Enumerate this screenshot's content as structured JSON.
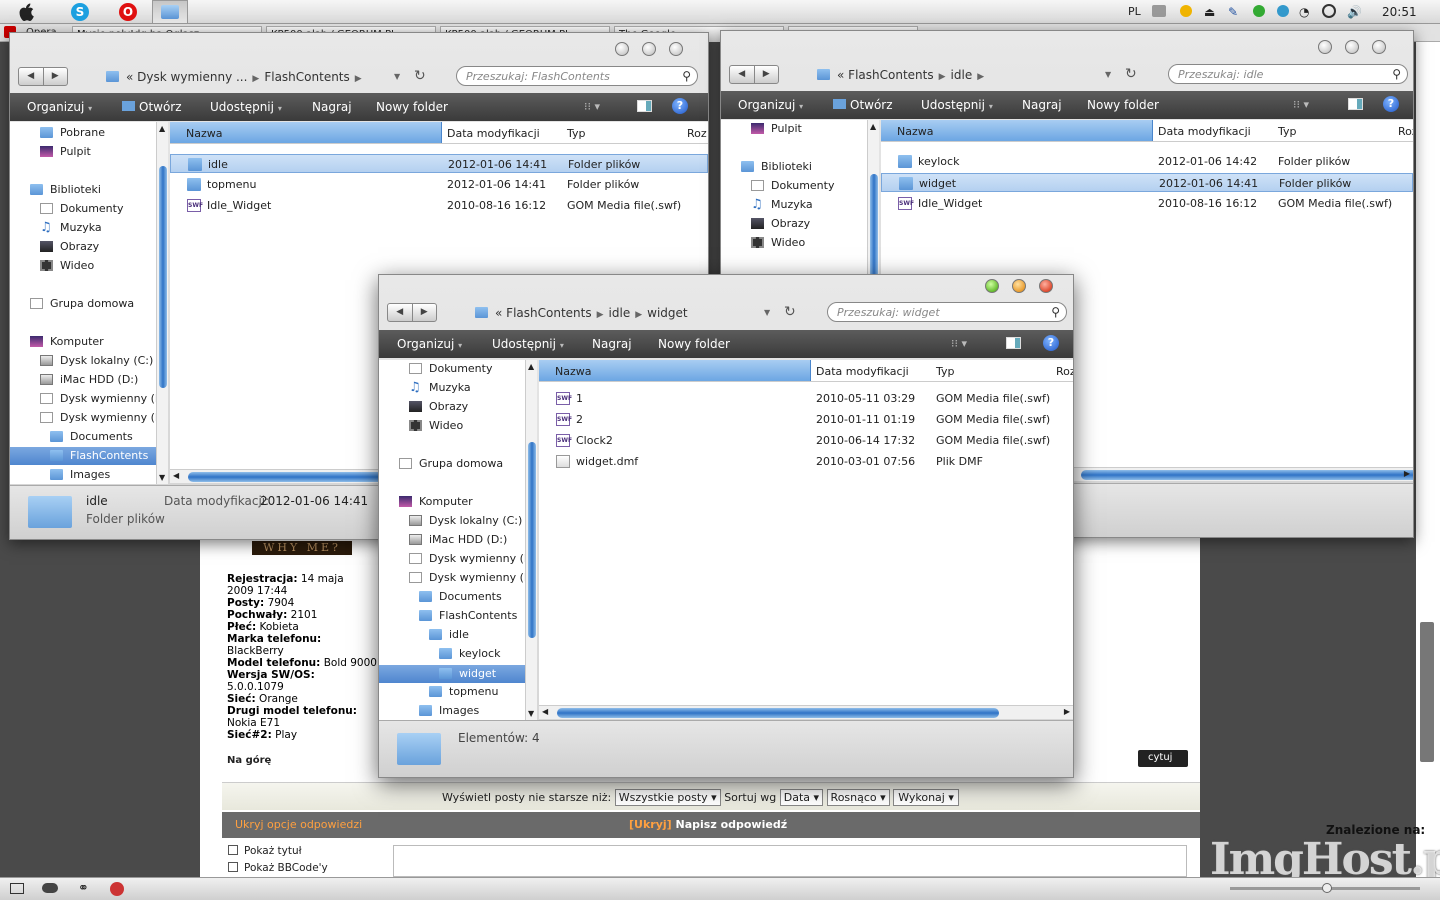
{
  "menubar": {
    "language": "PL",
    "clock": "20:51",
    "apps": [
      "apple-icon",
      "skype-icon",
      "opera-icon",
      "finder-icon"
    ]
  },
  "browser": {
    "app_name": "Opera",
    "tabs": [
      "Mysie poly!dg ha Oglasz",
      "KP500 alab / GEORUM PL",
      "KP500 alab / GEORUM PL",
      "The Google"
    ]
  },
  "forum": {
    "banner": "WHY ME?",
    "profile": [
      {
        "label": "Rejestracja:",
        "value": " 14 maja 2009 17:44"
      },
      {
        "label": "Posty:",
        "value": " 7904"
      },
      {
        "label": "Pochwały:",
        "value": " 2101"
      },
      {
        "label": "Płeć:",
        "value": " Kobieta"
      },
      {
        "label": "Marka telefonu:",
        "value": " BlackBerry"
      },
      {
        "label": "Model telefonu:",
        "value": " Bold 9000"
      },
      {
        "label": "Wersja SW/OS:",
        "value": " 5.0.0.1079"
      },
      {
        "label": "Sieć:",
        "value": " Orange"
      },
      {
        "label": "Drugi model telefonu:",
        "value": " Nokia E71"
      },
      {
        "label": "Sieć#2:",
        "value": " Play"
      }
    ],
    "top_link": "Na górę",
    "quote_button": "cytuj",
    "filter": {
      "label": "Wyświetl posty nie starsze niż:",
      "all_posts": "Wszystkie posty",
      "sort_label": "Sortuj wg",
      "sort_value": "Data",
      "order_value": "Rosnąco",
      "go_button": "Wykonaj"
    },
    "reply_bar": {
      "hide_options": "Ukryj opcje odpowiedzi",
      "hide_tag": "[Ukryj]",
      "write_reply": "Napisz odpowiedź"
    },
    "checkboxes": [
      "Pokaż tytuł",
      "Pokaż BBCode'y"
    ],
    "found_on": "Znalezione na:",
    "watermark": "ImgHost.pl"
  },
  "windows": {
    "w1": {
      "breadcrumb": [
        "«",
        "Dysk wymienny ...",
        "FlashContents"
      ],
      "search_placeholder": "Przeszukaj: FlashContents",
      "toolbar": {
        "organize": "Organizuj",
        "open": "Otwórz",
        "share": "Udostępnij",
        "burn": "Nagraj",
        "new_folder": "Nowy folder"
      },
      "columns": {
        "name": "Nazwa",
        "date": "Data modyfikacji",
        "type": "Typ",
        "size": "Roz"
      },
      "nav": [
        "Pobrane",
        "Pulpit",
        "Biblioteki",
        "Dokumenty",
        "Muzyka",
        "Obrazy",
        "Wideo",
        "Grupa domowa",
        "Komputer",
        "Dysk lokalny (C:)",
        "iMac HDD (D:)",
        "Dysk wymienny (F",
        "Dysk wymienny (I",
        "Documents",
        "FlashContents",
        "Images"
      ],
      "rows": [
        {
          "name": "idle",
          "date": "2012-01-06 14:41",
          "type": "Folder plików",
          "icon": "folder"
        },
        {
          "name": "topmenu",
          "date": "2012-01-06 14:41",
          "type": "Folder plików",
          "icon": "folder"
        },
        {
          "name": "Idle_Widget",
          "date": "2010-08-16 16:12",
          "type": "GOM Media file(.swf)",
          "icon": "swf"
        }
      ],
      "status": {
        "name": "idle",
        "date_label": "Data modyfikacji:",
        "date": "2012-01-06 14:41",
        "kind": "Folder plików"
      }
    },
    "w2": {
      "breadcrumb": [
        "«",
        "FlashContents",
        "idle"
      ],
      "search_placeholder": "Przeszukaj: idle",
      "toolbar": {
        "organize": "Organizuj",
        "open": "Otwórz",
        "share": "Udostępnij",
        "burn": "Nagraj",
        "new_folder": "Nowy folder"
      },
      "columns": {
        "name": "Nazwa",
        "date": "Data modyfikacji",
        "type": "Typ",
        "size": "Roz"
      },
      "nav": [
        "Pulpit",
        "Biblioteki",
        "Dokumenty",
        "Muzyka",
        "Obrazy",
        "Wideo"
      ],
      "rows": [
        {
          "name": "keylock",
          "date": "2012-01-06 14:42",
          "type": "Folder plików",
          "icon": "folder"
        },
        {
          "name": "widget",
          "date": "2012-01-06 14:41",
          "type": "Folder plików",
          "icon": "folder"
        },
        {
          "name": "Idle_Widget",
          "date": "2010-08-16 16:12",
          "type": "GOM Media file(.swf)",
          "icon": "swf"
        }
      ]
    },
    "w3": {
      "breadcrumb": [
        "«",
        "FlashContents",
        "idle",
        "widget"
      ],
      "search_placeholder": "Przeszukaj: widget",
      "toolbar": {
        "organize": "Organizuj",
        "share": "Udostępnij",
        "burn": "Nagraj",
        "new_folder": "Nowy folder"
      },
      "columns": {
        "name": "Nazwa",
        "date": "Data modyfikacji",
        "type": "Typ",
        "size": "Roz"
      },
      "nav": [
        "Dokumenty",
        "Muzyka",
        "Obrazy",
        "Wideo",
        "Grupa domowa",
        "Komputer",
        "Dysk lokalny (C:)",
        "iMac HDD (D:)",
        "Dysk wymienny (F",
        "Dysk wymienny (I",
        "Documents",
        "FlashContents",
        "idle",
        "keylock",
        "widget",
        "topmenu",
        "Images"
      ],
      "rows": [
        {
          "name": "1",
          "date": "2010-05-11 03:29",
          "type": "GOM Media file(.swf)",
          "icon": "swf"
        },
        {
          "name": "2",
          "date": "2010-01-11 01:19",
          "type": "GOM Media file(.swf)",
          "icon": "swf"
        },
        {
          "name": "Clock2",
          "date": "2010-06-14 17:32",
          "type": "GOM Media file(.swf)",
          "icon": "swf"
        },
        {
          "name": "widget.dmf",
          "date": "2010-03-01 07:56",
          "type": "Plik DMF",
          "icon": "doc"
        }
      ],
      "status": {
        "count": "Elementów: 4"
      }
    }
  }
}
